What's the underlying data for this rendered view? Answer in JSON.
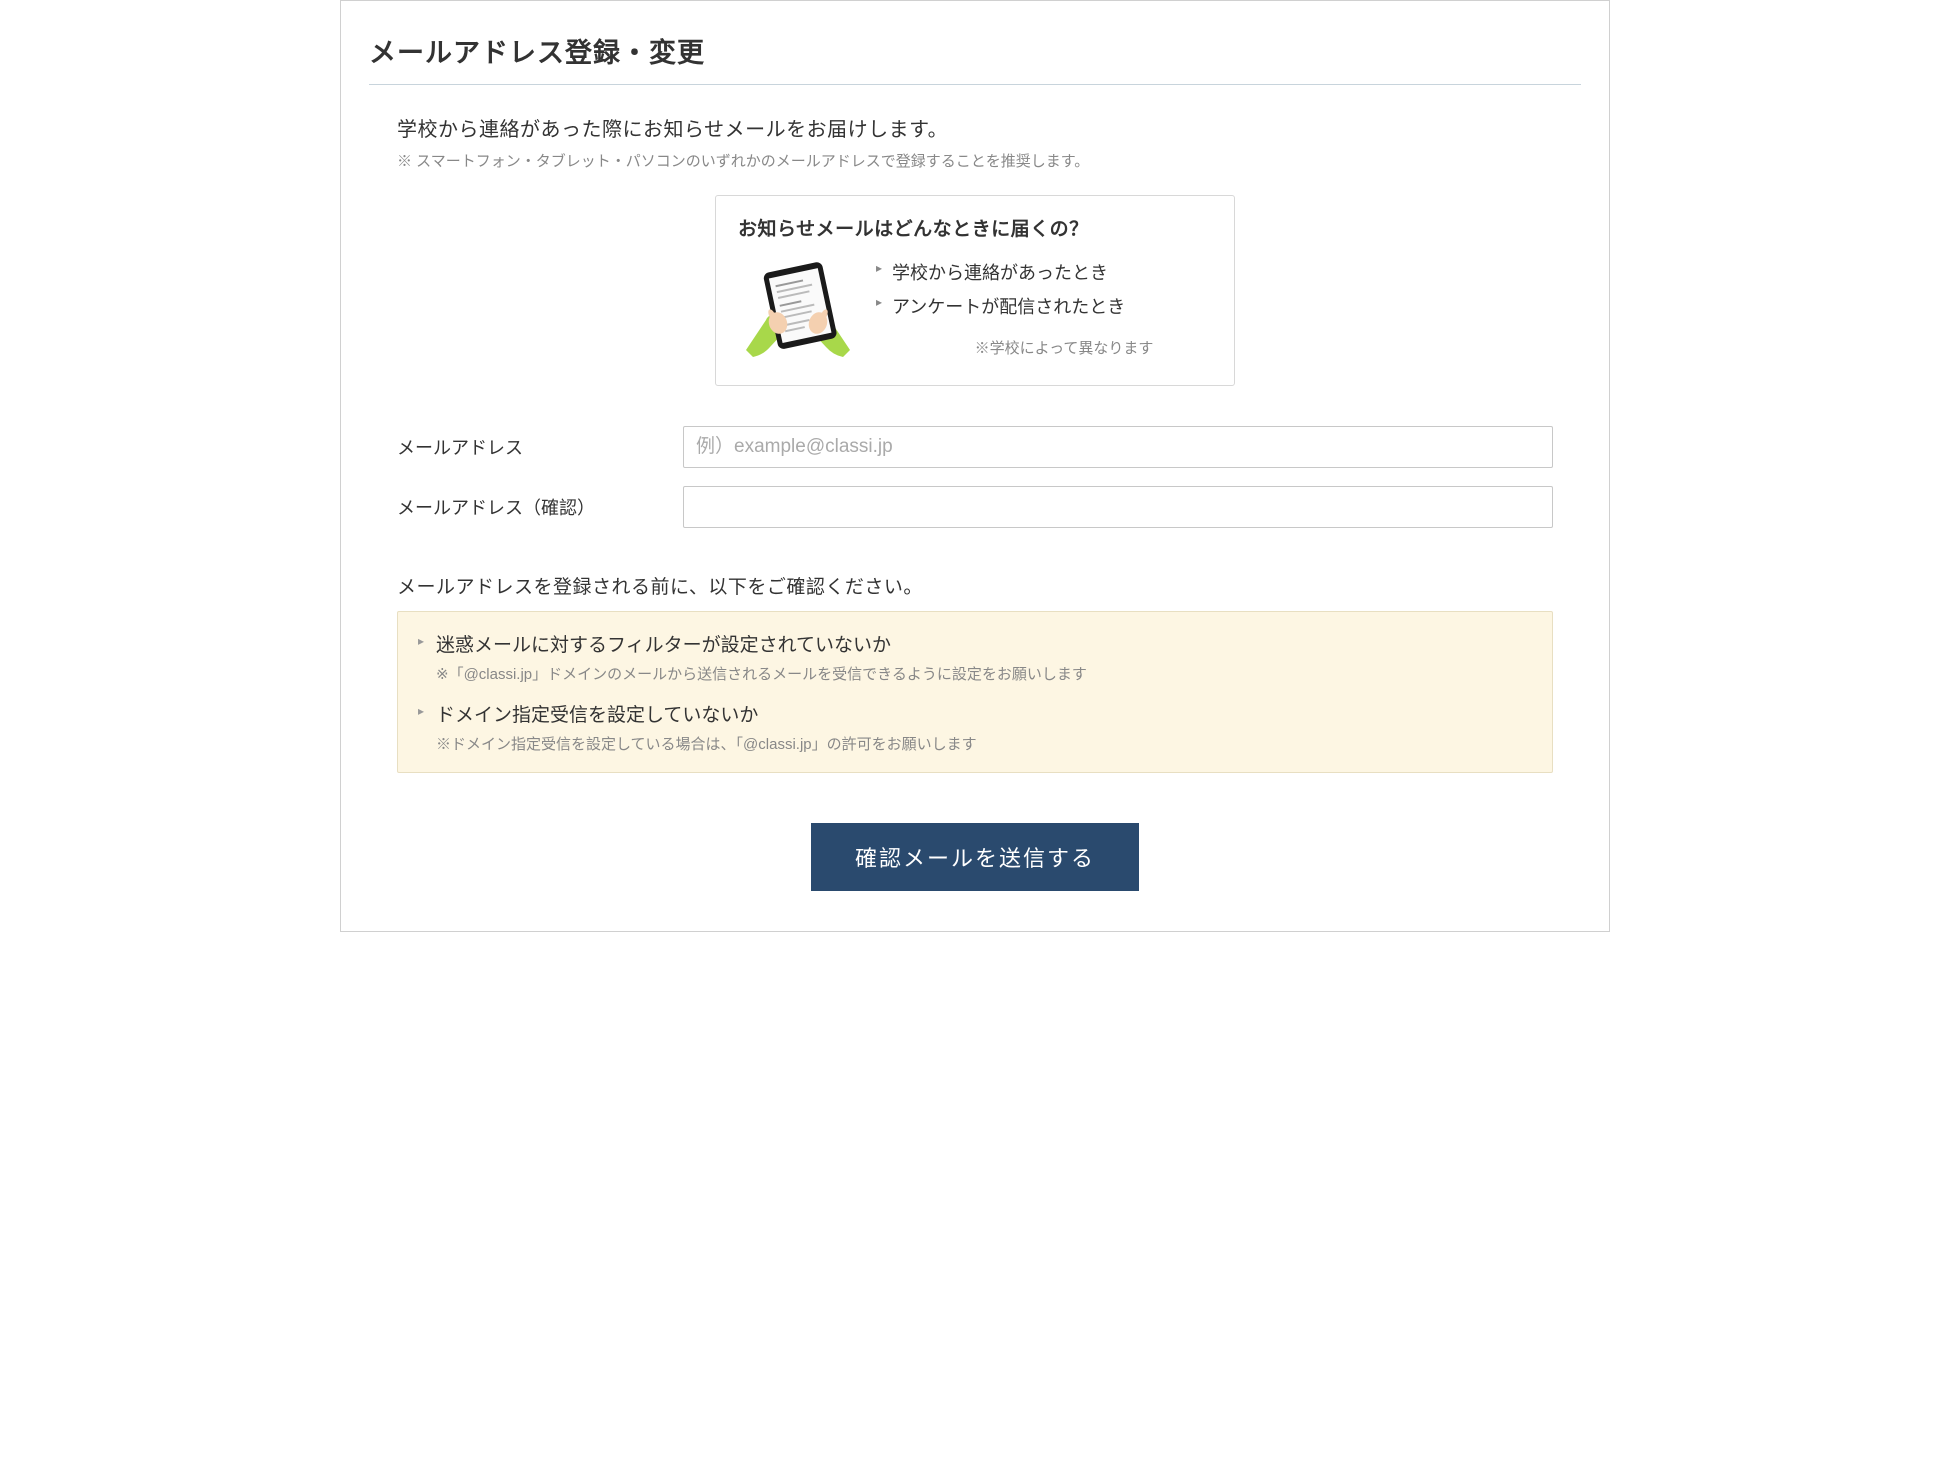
{
  "page": {
    "title": "メールアドレス登録・変更"
  },
  "intro": {
    "text": "学校から連絡があった際にお知らせメールをお届けします。",
    "note": "※ スマートフォン・タブレット・パソコンのいずれかのメールアドレスで登録することを推奨します。"
  },
  "info_box": {
    "title": "お知らせメールはどんなときに届くの？",
    "items": [
      "学校から連絡があったとき",
      "アンケートが配信されたとき"
    ],
    "sub_note": "※学校によって異なります"
  },
  "form": {
    "email_label": "メールアドレス",
    "email_placeholder": "例）example@classi.jp",
    "email_value": "",
    "email_confirm_label": "メールアドレス（確認）",
    "email_confirm_value": ""
  },
  "confirm": {
    "heading": "メールアドレスを登録される前に、以下をご確認ください。",
    "items": [
      {
        "title": "迷惑メールに対するフィルターが設定されていないか",
        "note": "※「@classi.jp」ドメインのメールから送信されるメールを受信できるように設定をお願いします"
      },
      {
        "title": "ドメイン指定受信を設定していないか",
        "note": "※ドメイン指定受信を設定している場合は、「@classi.jp」の許可をお願いします"
      }
    ]
  },
  "submit": {
    "button_label": "確認メールを送信する"
  }
}
